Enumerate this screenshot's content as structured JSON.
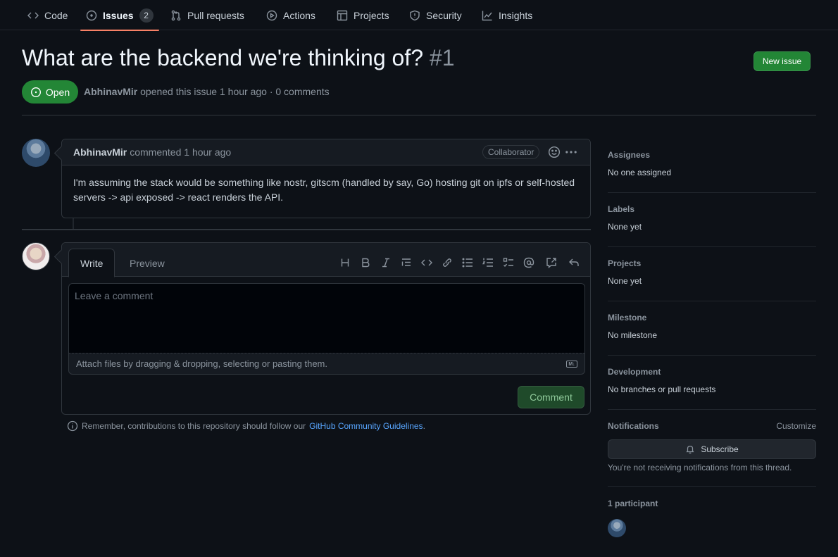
{
  "nav": {
    "tabs": [
      {
        "label": "Code",
        "icon": "code-icon"
      },
      {
        "label": "Issues",
        "icon": "issue-opened-icon",
        "counter": "2"
      },
      {
        "label": "Pull requests",
        "icon": "git-pull-request-icon"
      },
      {
        "label": "Actions",
        "icon": "play-icon"
      },
      {
        "label": "Projects",
        "icon": "table-icon"
      },
      {
        "label": "Security",
        "icon": "shield-icon"
      },
      {
        "label": "Insights",
        "icon": "graph-icon"
      }
    ]
  },
  "header": {
    "title": "What are the backend we're thinking of?",
    "number": "#1",
    "new_issue_label": "New issue",
    "state_label": "Open",
    "author": "AbhinavMir",
    "meta_text": "opened this issue 1 hour ago · 0 comments"
  },
  "comment": {
    "author": "AbhinavMir",
    "action": "commented 1 hour ago",
    "badge": "Collaborator",
    "body": "I'm assuming the stack would be something like nostr, gitscm (handled by say, Go) hosting git on ipfs or self-hosted servers -> api exposed -> react renders the API."
  },
  "form": {
    "tab_write": "Write",
    "tab_preview": "Preview",
    "placeholder": "Leave a comment",
    "attach_hint": "Attach files by dragging & dropping, selecting or pasting them.",
    "submit_label": "Comment",
    "toolbar": [
      "heading-icon",
      "bold-icon",
      "italic-icon",
      "quote-icon",
      "code-icon",
      "link-icon",
      "unordered-list-icon",
      "ordered-list-icon",
      "task-list-icon",
      "mention-icon",
      "cross-reference-icon",
      "reply-icon"
    ]
  },
  "guidelines": {
    "text": "Remember, contributions to this repository should follow our",
    "link": "GitHub Community Guidelines",
    "suffix": "."
  },
  "sidebar": {
    "assignees": {
      "heading": "Assignees",
      "value": "No one assigned"
    },
    "labels": {
      "heading": "Labels",
      "value": "None yet"
    },
    "projects": {
      "heading": "Projects",
      "value": "None yet"
    },
    "milestone": {
      "heading": "Milestone",
      "value": "No milestone"
    },
    "development": {
      "heading": "Development",
      "value": "No branches or pull requests"
    },
    "notifications": {
      "heading": "Notifications",
      "customize": "Customize",
      "subscribe_label": "Subscribe",
      "note": "You're not receiving notifications from this thread."
    },
    "participants": {
      "heading": "1 participant"
    }
  },
  "colors": {
    "background": "#0d1117",
    "primary_green": "#238636",
    "accent_underline": "#f78166",
    "link": "#58a6ff"
  }
}
